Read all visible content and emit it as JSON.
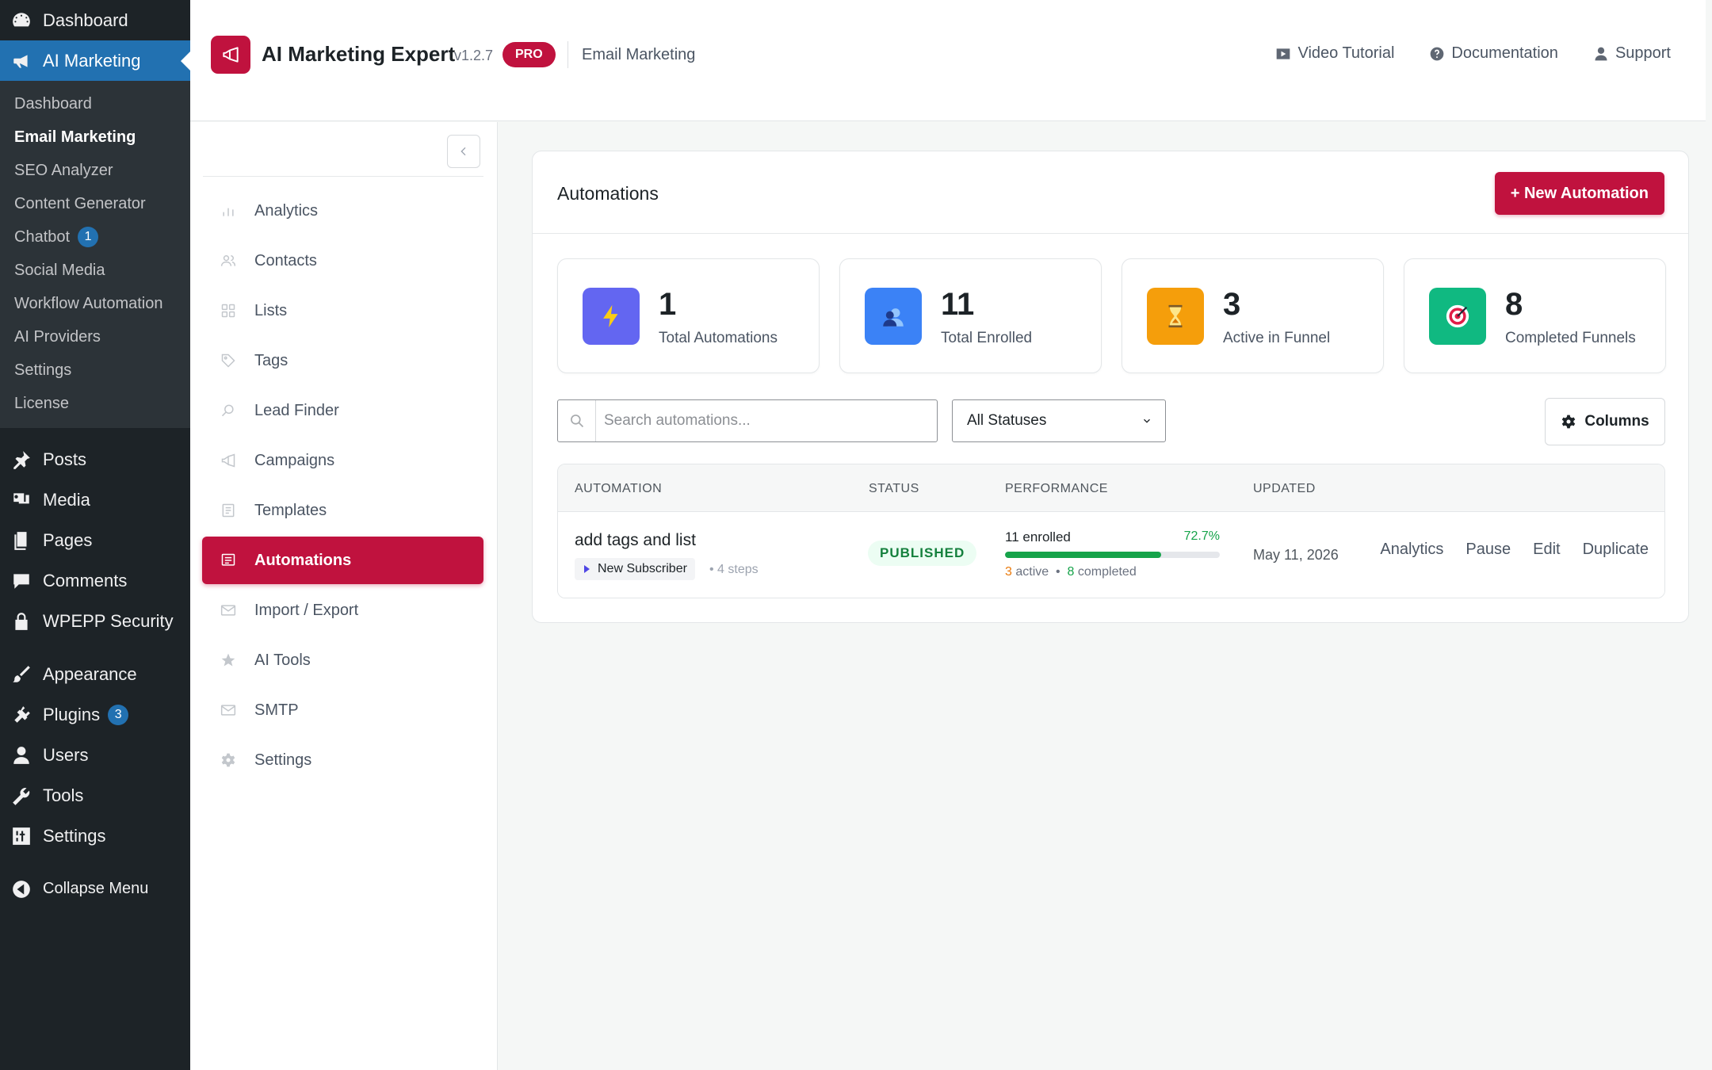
{
  "wp_menu": {
    "top_items": [
      {
        "label": "Dashboard",
        "icon": "dashboard-icon"
      },
      {
        "label": "AI Marketing",
        "icon": "megaphone-icon"
      }
    ],
    "ai_submenu": [
      {
        "label": "Dashboard"
      },
      {
        "label": "Email Marketing"
      },
      {
        "label": "SEO Analyzer"
      },
      {
        "label": "Content Generator"
      },
      {
        "label": "Chatbot",
        "badge": "1"
      },
      {
        "label": "Social Media"
      },
      {
        "label": "Workflow Automation"
      },
      {
        "label": "AI Providers"
      },
      {
        "label": "Settings"
      },
      {
        "label": "License"
      }
    ],
    "items": [
      {
        "label": "Posts",
        "icon": "pin-icon"
      },
      {
        "label": "Media",
        "icon": "media-icon"
      },
      {
        "label": "Pages",
        "icon": "pages-icon"
      },
      {
        "label": "Comments",
        "icon": "comment-icon"
      },
      {
        "label": "WPEPP Security",
        "icon": "lock-icon"
      },
      {
        "label": "Appearance",
        "icon": "brush-icon"
      },
      {
        "label": "Plugins",
        "icon": "plugin-icon",
        "badge": "3"
      },
      {
        "label": "Users",
        "icon": "user-icon"
      },
      {
        "label": "Tools",
        "icon": "wrench-icon"
      },
      {
        "label": "Settings",
        "icon": "settings-icon"
      },
      {
        "label": "Collapse Menu",
        "icon": "collapse-icon"
      }
    ]
  },
  "header": {
    "app_title": "AI Marketing Expert",
    "version": "v1.2.7",
    "pro_badge": "PRO",
    "section": "Email Marketing",
    "links": [
      {
        "label": "Video Tutorial",
        "icon": "video-icon"
      },
      {
        "label": "Documentation",
        "icon": "help-icon"
      },
      {
        "label": "Support",
        "icon": "support-icon"
      }
    ]
  },
  "plugin_nav": {
    "items": [
      {
        "label": "Analytics",
        "icon": "bar-chart-icon"
      },
      {
        "label": "Contacts",
        "icon": "contacts-icon"
      },
      {
        "label": "Lists",
        "icon": "grid-icon"
      },
      {
        "label": "Tags",
        "icon": "tag-icon"
      },
      {
        "label": "Lead Finder",
        "icon": "search-icon"
      },
      {
        "label": "Campaigns",
        "icon": "megaphone-icon"
      },
      {
        "label": "Templates",
        "icon": "template-icon"
      },
      {
        "label": "Automations",
        "icon": "automation-icon",
        "active": true
      },
      {
        "label": "Import / Export",
        "icon": "mail-icon"
      },
      {
        "label": "AI Tools",
        "icon": "star-icon"
      },
      {
        "label": "SMTP",
        "icon": "mail-icon"
      },
      {
        "label": "Settings",
        "icon": "gear-icon"
      }
    ]
  },
  "automations": {
    "title": "Automations",
    "new_button": "+ New Automation",
    "stats": [
      {
        "value": "1",
        "label": "Total Automations",
        "icon": "lightning-icon",
        "color": "#6366f1"
      },
      {
        "value": "11",
        "label": "Total Enrolled",
        "icon": "users-icon",
        "color": "#3b82f6"
      },
      {
        "value": "3",
        "label": "Active in Funnel",
        "icon": "hourglass-icon",
        "color": "#f59e0b"
      },
      {
        "value": "8",
        "label": "Completed Funnels",
        "icon": "target-icon",
        "color": "#10b981"
      }
    ],
    "search_placeholder": "Search automations...",
    "status_filter": "All Statuses",
    "columns_button": "Columns",
    "table": {
      "headers": [
        "AUTOMATION",
        "STATUS",
        "PERFORMANCE",
        "UPDATED"
      ],
      "rows": [
        {
          "name": "add tags and list",
          "trigger": "New Subscriber",
          "steps": "• 4 steps",
          "status": "PUBLISHED",
          "enrolled": "11 enrolled",
          "percent": "72.7%",
          "progress": 0.727,
          "active_count": "3",
          "active_label": "active",
          "separator": "•",
          "completed_count": "8",
          "completed_label": "completed",
          "updated": "May 11, 2026",
          "actions": [
            "Analytics",
            "Pause",
            "Edit",
            "Duplicate"
          ]
        }
      ]
    }
  },
  "colors": {
    "brand": "#c0123e",
    "wp_sidebar": "#1d2327",
    "wp_active": "#2271b1",
    "success": "#16a34a"
  }
}
